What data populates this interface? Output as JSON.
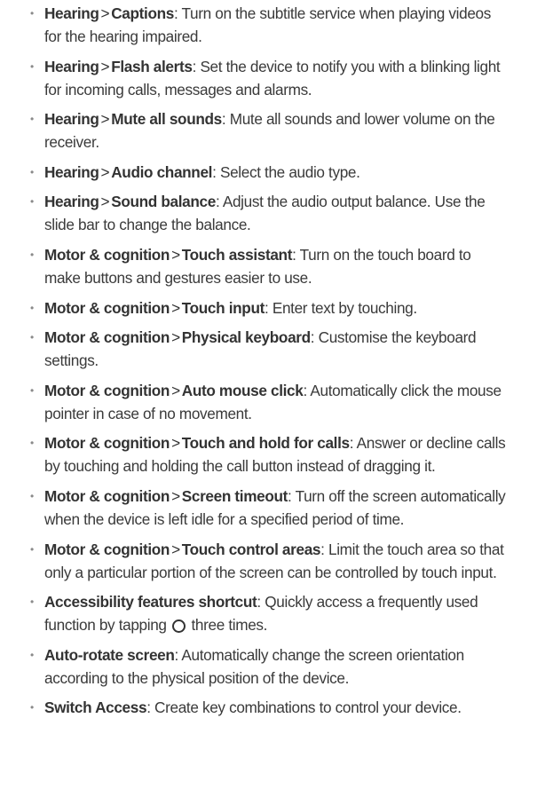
{
  "items": [
    {
      "category": "Hearing",
      "separator": ">",
      "term": "Captions",
      "colon": ":",
      "text": " Turn on the subtitle service when playing videos for the hearing impaired."
    },
    {
      "category": "Hearing",
      "separator": ">",
      "term": "Flash alerts",
      "colon": ":",
      "text": " Set the device to notify you with a blinking light for incoming calls, messages and alarms."
    },
    {
      "category": "Hearing",
      "separator": ">",
      "term": "Mute all sounds",
      "colon": ":",
      "text": " Mute all sounds and lower volume on the receiver."
    },
    {
      "category": "Hearing",
      "separator": ">",
      "term": "Audio channel",
      "colon": ":",
      "text": " Select the audio type."
    },
    {
      "category": "Hearing",
      "separator": ">",
      "term": "Sound balance",
      "colon": ":",
      "text": " Adjust the audio output balance. Use the slide bar to change the balance."
    },
    {
      "category": "Motor & cognition",
      "separator": ">",
      "term": "Touch assistant",
      "colon": ":",
      "text": " Turn on the touch board to make buttons and gestures easier to use."
    },
    {
      "category": "Motor & cognition",
      "separator": ">",
      "term": "Touch input",
      "colon": ":",
      "text": " Enter text by touching."
    },
    {
      "category": "Motor & cognition",
      "separator": ">",
      "term": "Physical keyboard",
      "colon": ":",
      "text": " Customise the keyboard settings."
    },
    {
      "category": "Motor & cognition",
      "separator": ">",
      "term": "Auto mouse click",
      "colon": ":",
      "text": " Automatically click the mouse pointer in case of no movement."
    },
    {
      "category": "Motor & cognition",
      "separator": ">",
      "term": "Touch and hold for calls",
      "colon": ":",
      "text": " Answer or decline calls by touching and holding the call button instead of dragging it."
    },
    {
      "category": "Motor & cognition",
      "separator": ">",
      "term": "Screen timeout",
      "colon": ":",
      "text": " Turn off the screen automatically when the device is left idle for a specified period of time."
    },
    {
      "category": "Motor & cognition",
      "separator": ">",
      "term": "Touch control areas",
      "colon": ":",
      "text": " Limit the touch area so that only a particular portion of the screen can be controlled by touch input."
    },
    {
      "category": "Accessibility features shortcut",
      "colon": ":",
      "text_before_icon": " Quickly access a frequently used function by tapping ",
      "icon": "home-circle-icon",
      "text_after_icon": " three times."
    },
    {
      "category": "Auto-rotate screen",
      "colon": ":",
      "text": " Automatically change the screen orientation according to the physical position of the device."
    },
    {
      "category": "Switch Access",
      "colon": ":",
      "text": " Create key combinations to control your device."
    }
  ]
}
